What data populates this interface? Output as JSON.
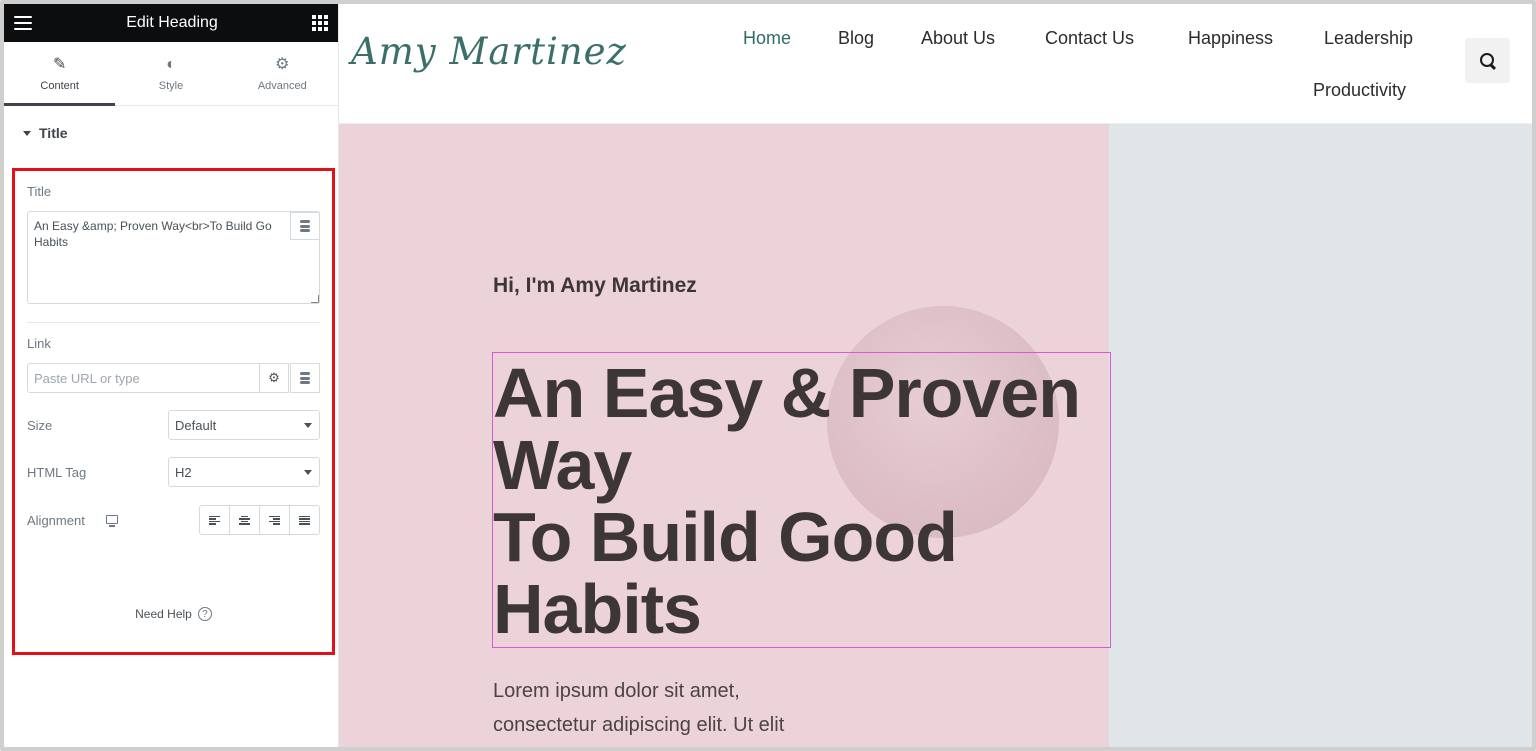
{
  "editor": {
    "header_title": "Edit Heading",
    "tabs": [
      {
        "label": "Content",
        "icon": "pencil-icon",
        "active": true
      },
      {
        "label": "Style",
        "icon": "contrast-icon",
        "active": false
      },
      {
        "label": "Advanced",
        "icon": "gear-icon",
        "active": false
      }
    ],
    "section_title": "Title",
    "title_label": "Title",
    "title_value": "An Easy &amp; Proven Way<br>To Build Go\nHabits",
    "link_label": "Link",
    "link_placeholder": "Paste URL or type",
    "size_label": "Size",
    "size_value": "Default",
    "html_tag_label": "HTML Tag",
    "html_tag_value": "H2",
    "alignment_label": "Alignment",
    "need_help": "Need Help",
    "highlight_color": "#e3101b"
  },
  "site": {
    "logo": "Amy Martinez",
    "nav": [
      {
        "label": "Home",
        "active": true
      },
      {
        "label": "Blog",
        "active": false
      },
      {
        "label": "About Us",
        "active": false
      },
      {
        "label": "Contact Us",
        "active": false
      },
      {
        "label": "Happiness",
        "active": false
      },
      {
        "label": "Leadership",
        "active": false
      },
      {
        "label": "Productivity",
        "active": false
      }
    ],
    "hero": {
      "subtitle": "Hi, I'm Amy Martinez",
      "heading_lines": [
        "An Easy & Proven",
        "Way",
        "To Build Good",
        "Habits"
      ],
      "body_lines": [
        "Lorem ipsum dolor sit amet,",
        "consectetur adipiscing elit. Ut elit"
      ]
    },
    "accent_color": "#2f6b66",
    "hero_bg_color": "#ecd3da"
  }
}
